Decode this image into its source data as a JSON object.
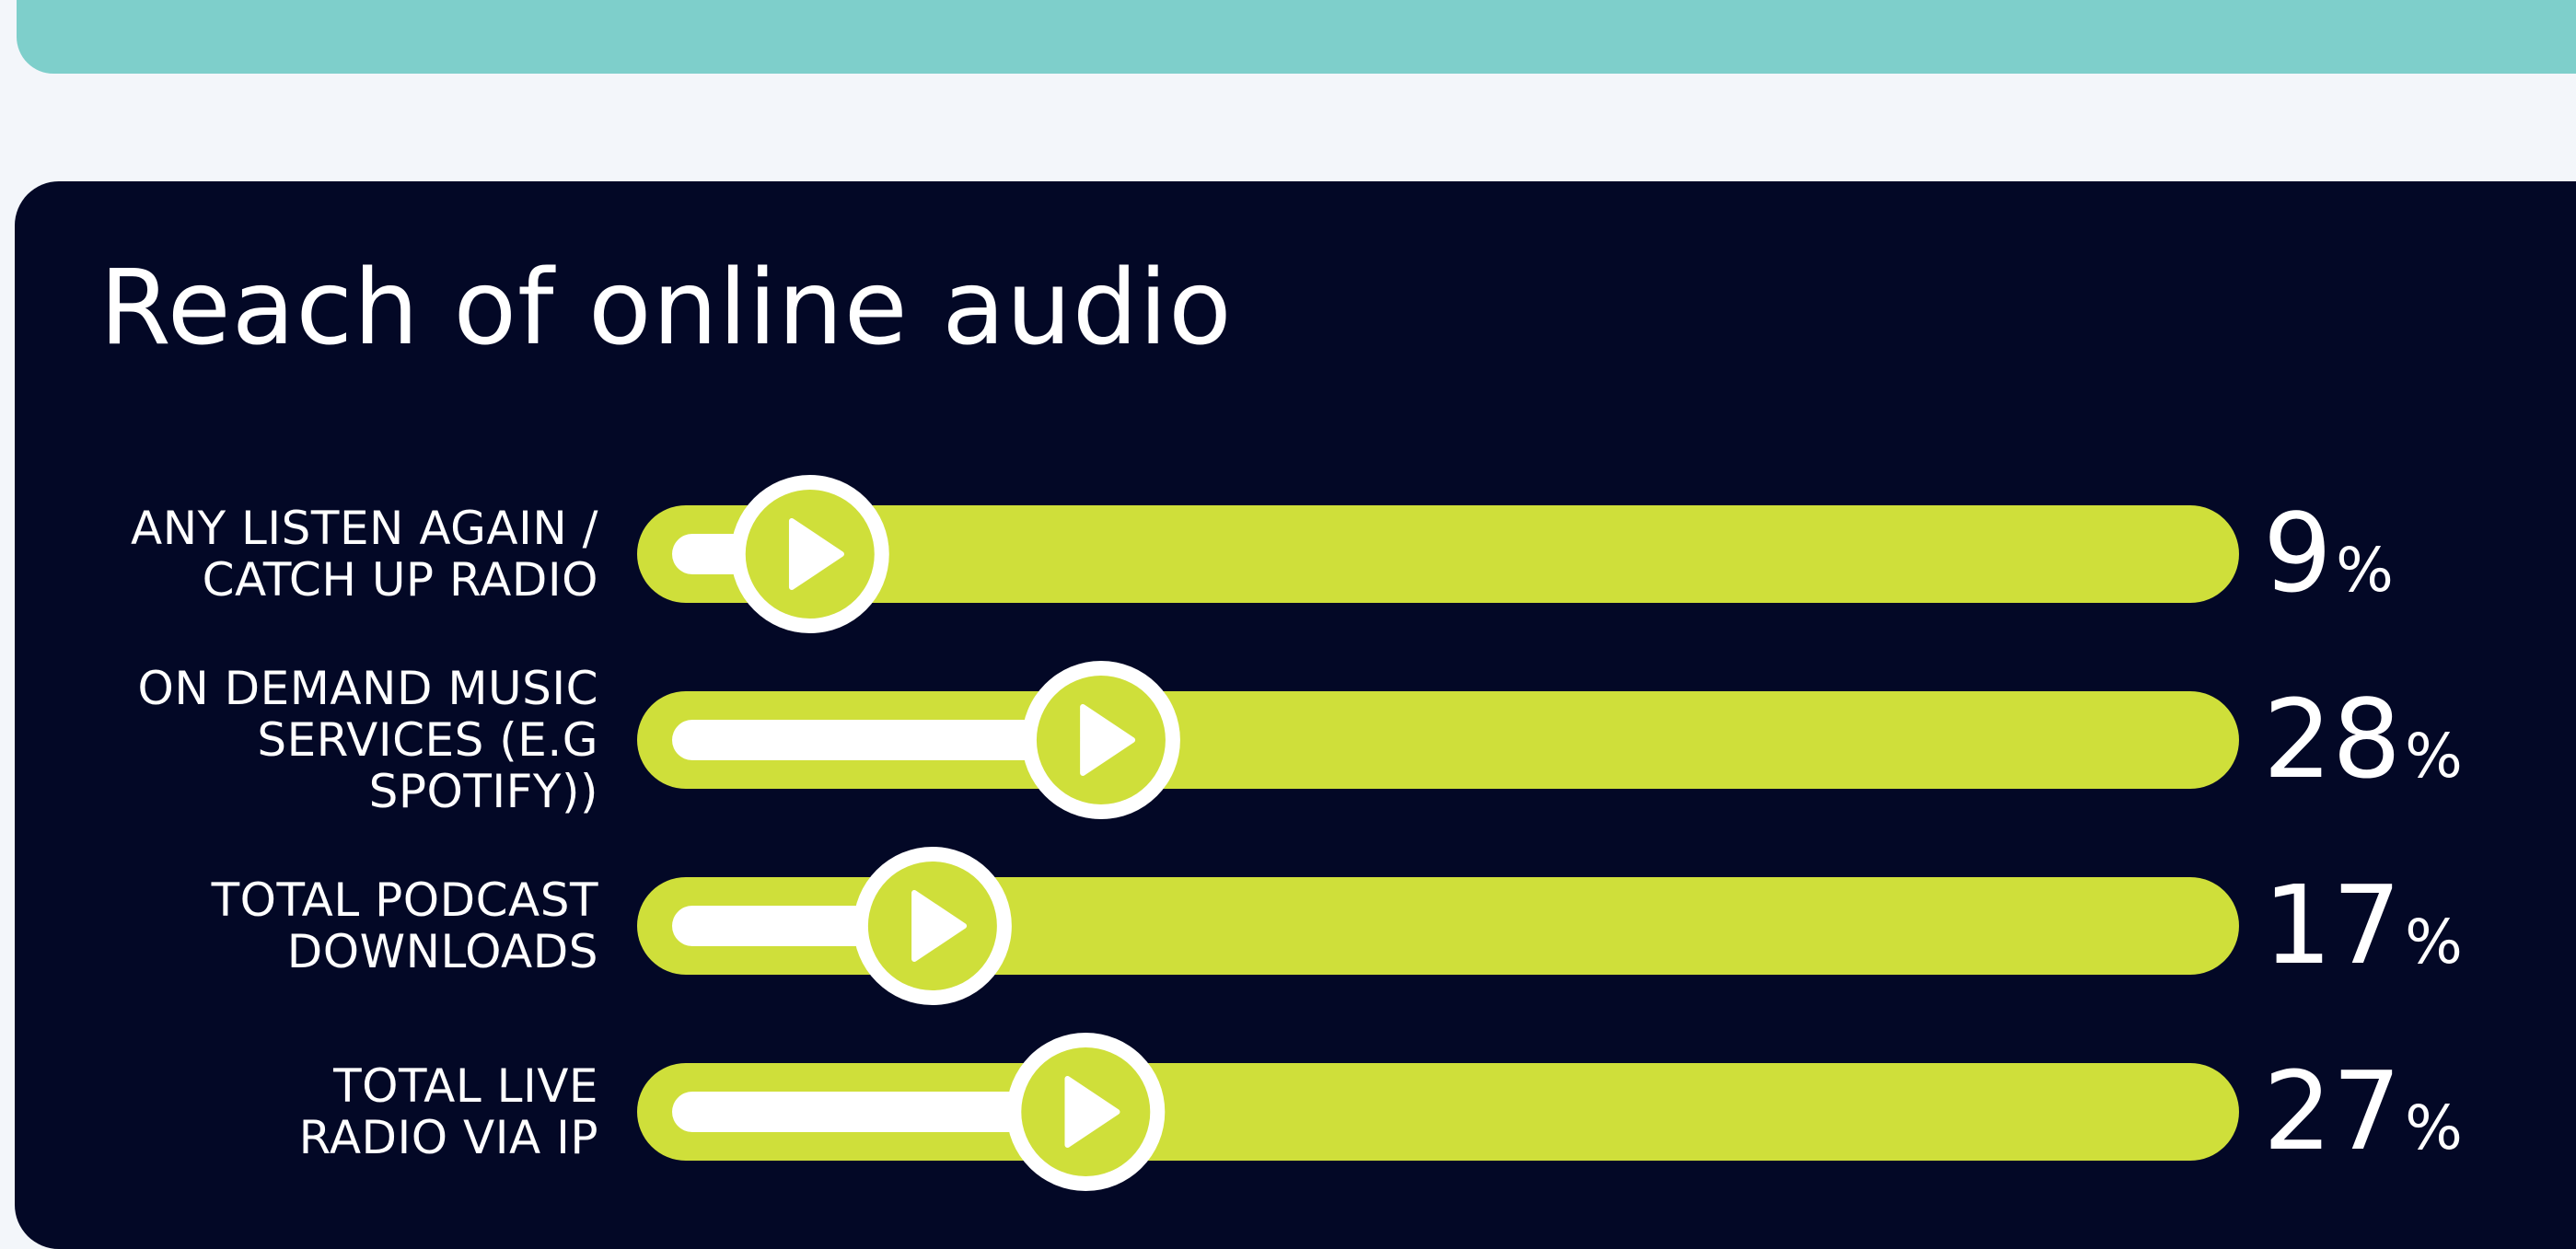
{
  "title": "Reach of online audio",
  "colors": {
    "background": "#f3f6fa",
    "banner": "#7ecfcb",
    "panel": "#030826",
    "track": "#cfdf3a",
    "fill": "#ffffff",
    "text": "#ffffff"
  },
  "chart_data": {
    "type": "bar",
    "orientation": "horizontal",
    "title": "Reach of online audio",
    "categories": [
      "ANY LISTEN AGAIN / CATCH UP RADIO",
      "ON DEMAND MUSIC SERVICES (E.G SPOTIFY))",
      "TOTAL PODCAST DOWNLOADS",
      "TOTAL LIVE RADIO VIA IP"
    ],
    "values": [
      9,
      28,
      17,
      27
    ],
    "value_suffix": "%",
    "xlim": [
      0,
      100
    ],
    "grid": false,
    "legend": "none"
  },
  "rows": [
    {
      "label_lines": [
        "ANY LISTEN AGAIN /",
        "CATCH UP RADIO"
      ],
      "value": "9",
      "unit": "%"
    },
    {
      "label_lines": [
        "ON DEMAND MUSIC",
        "SERVICES (E.G",
        "SPOTIFY))"
      ],
      "value": "28",
      "unit": "%"
    },
    {
      "label_lines": [
        "TOTAL PODCAST",
        "DOWNLOADS"
      ],
      "value": "17",
      "unit": "%"
    },
    {
      "label_lines": [
        "TOTAL LIVE",
        "RADIO VIA IP"
      ],
      "value": "27",
      "unit": "%"
    }
  ]
}
